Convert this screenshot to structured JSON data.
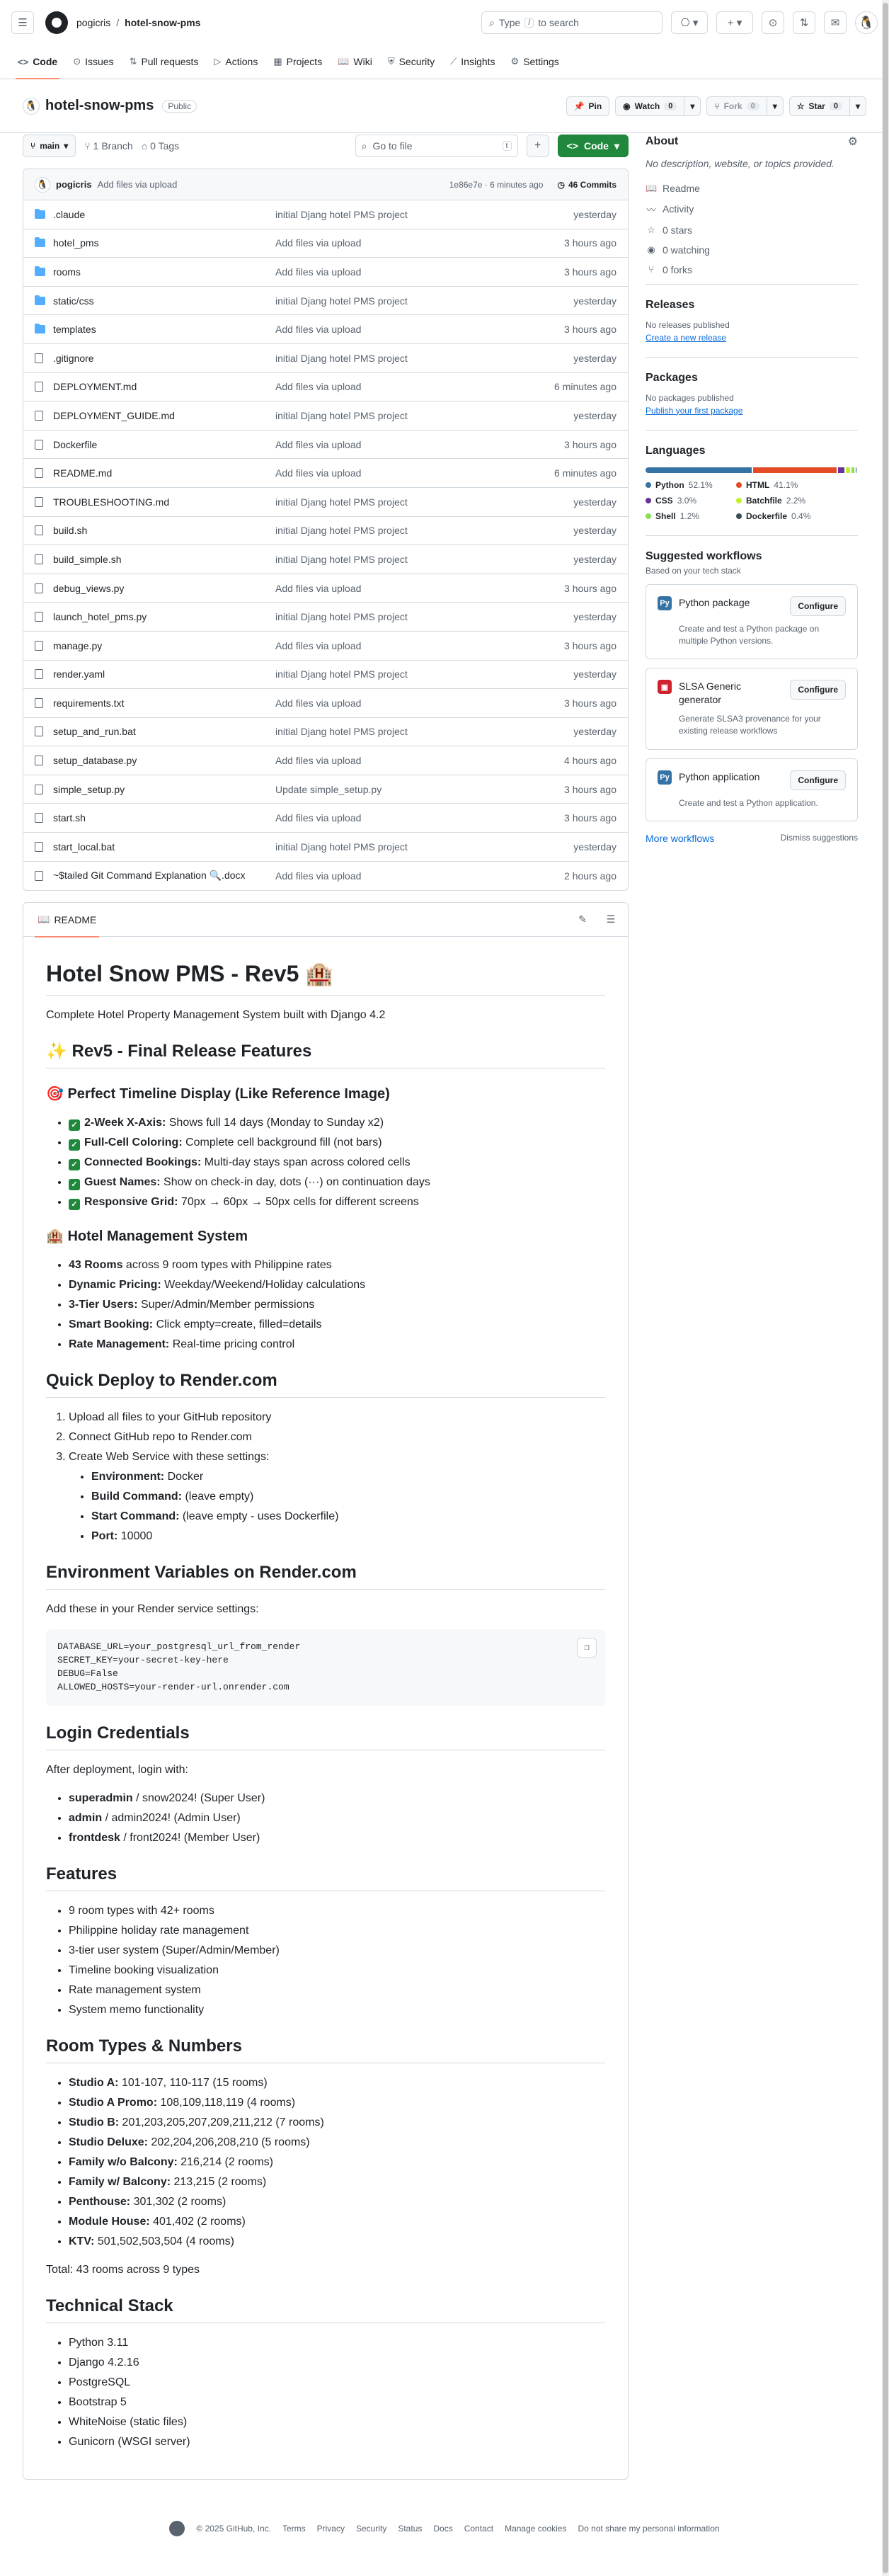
{
  "header": {
    "owner": "pogicris",
    "repo": "hotel-snow-pms",
    "search_placeholder": "Type / to search",
    "search_kbd": "/"
  },
  "tabs": [
    {
      "label": "Code",
      "icon": "code-icon"
    },
    {
      "label": "Issues",
      "icon": "issue-icon"
    },
    {
      "label": "Pull requests",
      "icon": "pull-request-icon"
    },
    {
      "label": "Actions",
      "icon": "actions-icon"
    },
    {
      "label": "Projects",
      "icon": "projects-icon"
    },
    {
      "label": "Wiki",
      "icon": "wiki-icon"
    },
    {
      "label": "Security",
      "icon": "shield-icon"
    },
    {
      "label": "Insights",
      "icon": "graph-icon"
    },
    {
      "label": "Settings",
      "icon": "gear-icon"
    }
  ],
  "repohead": {
    "name": "hotel-snow-pms",
    "visibility": "Public",
    "pin": "Pin",
    "watch": "Watch",
    "watch_count": "0",
    "fork": "Fork",
    "fork_count": "0",
    "star": "Star",
    "star_count": "0"
  },
  "toolbar": {
    "branch": "main",
    "branches": "1 Branch",
    "tags": "0 Tags",
    "goto_placeholder": "Go to file",
    "goto_kbd": "t",
    "code": "Code"
  },
  "commit": {
    "user": "pogicris",
    "message": "Add files via upload",
    "hash_time": "1e86e7e · 6 minutes ago",
    "commits": "46 Commits"
  },
  "files": [
    {
      "name": ".claude",
      "type": "dir",
      "msg": "initial Djang hotel PMS project",
      "date": "yesterday"
    },
    {
      "name": "hotel_pms",
      "type": "dir",
      "msg": "Add files via upload",
      "date": "3 hours ago"
    },
    {
      "name": "rooms",
      "type": "dir",
      "msg": "Add files via upload",
      "date": "3 hours ago"
    },
    {
      "name": "static/css",
      "type": "dir",
      "msg": "initial Djang hotel PMS project",
      "date": "yesterday"
    },
    {
      "name": "templates",
      "type": "dir",
      "msg": "Add files via upload",
      "date": "3 hours ago"
    },
    {
      "name": ".gitignore",
      "type": "file",
      "msg": "initial Djang hotel PMS project",
      "date": "yesterday"
    },
    {
      "name": "DEPLOYMENT.md",
      "type": "file",
      "msg": "Add files via upload",
      "date": "6 minutes ago"
    },
    {
      "name": "DEPLOYMENT_GUIDE.md",
      "type": "file",
      "msg": "initial Djang hotel PMS project",
      "date": "yesterday"
    },
    {
      "name": "Dockerfile",
      "type": "file",
      "msg": "Add files via upload",
      "date": "3 hours ago"
    },
    {
      "name": "README.md",
      "type": "file",
      "msg": "Add files via upload",
      "date": "6 minutes ago"
    },
    {
      "name": "TROUBLESHOOTING.md",
      "type": "file",
      "msg": "initial Djang hotel PMS project",
      "date": "yesterday"
    },
    {
      "name": "build.sh",
      "type": "file",
      "msg": "initial Djang hotel PMS project",
      "date": "yesterday"
    },
    {
      "name": "build_simple.sh",
      "type": "file",
      "msg": "initial Djang hotel PMS project",
      "date": "yesterday"
    },
    {
      "name": "debug_views.py",
      "type": "file",
      "msg": "Add files via upload",
      "date": "3 hours ago"
    },
    {
      "name": "launch_hotel_pms.py",
      "type": "file",
      "msg": "initial Djang hotel PMS project",
      "date": "yesterday"
    },
    {
      "name": "manage.py",
      "type": "file",
      "msg": "Add files via upload",
      "date": "3 hours ago"
    },
    {
      "name": "render.yaml",
      "type": "file",
      "msg": "initial Djang hotel PMS project",
      "date": "yesterday"
    },
    {
      "name": "requirements.txt",
      "type": "file",
      "msg": "Add files via upload",
      "date": "3 hours ago"
    },
    {
      "name": "setup_and_run.bat",
      "type": "file",
      "msg": "initial Djang hotel PMS project",
      "date": "yesterday"
    },
    {
      "name": "setup_database.py",
      "type": "file",
      "msg": "Add files via upload",
      "date": "4 hours ago"
    },
    {
      "name": "simple_setup.py",
      "type": "file",
      "msg": "Update simple_setup.py",
      "date": "3 hours ago"
    },
    {
      "name": "start.sh",
      "type": "file",
      "msg": "Add files via upload",
      "date": "3 hours ago"
    },
    {
      "name": "start_local.bat",
      "type": "file",
      "msg": "initial Djang hotel PMS project",
      "date": "yesterday"
    },
    {
      "name": "~$tailed Git Command Explanation 🔍.docx",
      "type": "file",
      "msg": "Add files via upload",
      "date": "2 hours ago"
    }
  ],
  "readme": {
    "tab": "README",
    "h1": "Hotel Snow PMS - Rev5 🏨",
    "intro": "Complete Hotel Property Management System built with Django 4.2",
    "h2_features": "✨ Rev5 - Final Release Features",
    "h3_timeline": "🎯 Perfect Timeline Display (Like Reference Image)",
    "timeline_items": [
      {
        "bold": "2-Week X-Axis:",
        "rest": " Shows full 14 days (Monday to Sunday x2)"
      },
      {
        "bold": "Full-Cell Coloring:",
        "rest": " Complete cell background fill (not bars)"
      },
      {
        "bold": "Connected Bookings:",
        "rest": " Multi-day stays span across colored cells"
      },
      {
        "bold": "Guest Names:",
        "rest": " Show on check-in day, dots (···) on continuation days"
      },
      {
        "bold": "Responsive Grid:",
        "rest": " 70px → 60px → 50px cells for different screens"
      }
    ],
    "h3_mgmt": "🏨 Hotel Management System",
    "mgmt_items": [
      {
        "bold": "43 Rooms",
        "rest": " across 9 room types with Philippine rates"
      },
      {
        "bold": "Dynamic Pricing:",
        "rest": " Weekday/Weekend/Holiday calculations"
      },
      {
        "bold": "3-Tier Users:",
        "rest": " Super/Admin/Member permissions"
      },
      {
        "bold": "Smart Booking:",
        "rest": " Click empty=create, filled=details"
      },
      {
        "bold": "Rate Management:",
        "rest": " Real-time pricing control"
      }
    ],
    "h2_deploy": "Quick Deploy to Render.com",
    "deploy_steps": [
      "Upload all files to your GitHub repository",
      "Connect GitHub repo to Render.com",
      "Create Web Service with these settings:"
    ],
    "deploy_settings": [
      {
        "bold": "Environment:",
        "rest": " Docker"
      },
      {
        "bold": "Build Command:",
        "rest": " (leave empty)"
      },
      {
        "bold": "Start Command:",
        "rest": " (leave empty - uses Dockerfile)"
      },
      {
        "bold": "Port:",
        "rest": " 10000"
      }
    ],
    "h2_env": "Environment Variables on Render.com",
    "env_intro": "Add these in your Render service settings:",
    "env_code": [
      "DATABASE_URL=your_postgresql_url_from_render",
      "SECRET_KEY=your-secret-key-here",
      "DEBUG=False",
      "ALLOWED_HOSTS=your-render-url.onrender.com"
    ],
    "h2_login": "Login Credentials",
    "login_intro": "After deployment, login with:",
    "login_items": [
      {
        "bold": "superadmin",
        "rest": " / snow2024! (Super User)"
      },
      {
        "bold": "admin",
        "rest": " / admin2024! (Admin User)"
      },
      {
        "bold": "frontdesk",
        "rest": " / front2024! (Member User)"
      }
    ],
    "h2_features2": "Features",
    "features_items": [
      "9 room types with 42+ rooms",
      "Philippine holiday rate management",
      "3-tier user system (Super/Admin/Member)",
      "Timeline booking visualization",
      "Rate management system",
      "System memo functionality"
    ],
    "h2_rooms": "Room Types & Numbers",
    "rooms_items": [
      {
        "bold": "Studio A:",
        "rest": " 101-107, 110-117 (15 rooms)"
      },
      {
        "bold": "Studio A Promo:",
        "rest": " 108,109,118,119 (4 rooms)"
      },
      {
        "bold": "Studio B:",
        "rest": " 201,203,205,207,209,211,212 (7 rooms)"
      },
      {
        "bold": "Studio Deluxe:",
        "rest": " 202,204,206,208,210 (5 rooms)"
      },
      {
        "bold": "Family w/o Balcony:",
        "rest": " 216,214 (2 rooms)"
      },
      {
        "bold": "Family w/ Balcony:",
        "rest": " 213,215 (2 rooms)"
      },
      {
        "bold": "Penthouse:",
        "rest": " 301,302 (2 rooms)"
      },
      {
        "bold": "Module House:",
        "rest": " 401,402 (2 rooms)"
      },
      {
        "bold": "KTV:",
        "rest": " 501,502,503,504 (4 rooms)"
      }
    ],
    "rooms_total": "Total: 43 rooms across 9 types",
    "h2_stack": "Technical Stack",
    "stack_items": [
      "Python 3.11",
      "Django 4.2.16",
      "PostgreSQL",
      "Bootstrap 5",
      "WhiteNoise (static files)",
      "Gunicorn (WSGI server)"
    ]
  },
  "about": {
    "title": "About",
    "desc": "No description, website, or topics provided.",
    "stats": [
      {
        "icon": "book-icon",
        "glyph": "📖",
        "label": "Readme"
      },
      {
        "icon": "pulse-icon",
        "glyph": "〰",
        "label": "Activity"
      },
      {
        "icon": "star-icon",
        "glyph": "☆",
        "label": "0 stars"
      },
      {
        "icon": "eye-icon",
        "glyph": "◉",
        "label": "0 watching"
      },
      {
        "icon": "fork-icon",
        "glyph": "⑂",
        "label": "0 forks"
      }
    ]
  },
  "releases": {
    "title": "Releases",
    "none": "No releases published",
    "link": "Create a new release"
  },
  "packages": {
    "title": "Packages",
    "none": "No packages published",
    "link": "Publish your first package"
  },
  "languages": {
    "title": "Languages",
    "items": [
      {
        "name": "Python",
        "pct": "52.1%",
        "value": 52.1,
        "color": "#3572A5"
      },
      {
        "name": "HTML",
        "pct": "41.1%",
        "value": 41.1,
        "color": "#e34c26"
      },
      {
        "name": "CSS",
        "pct": "3.0%",
        "value": 3.0,
        "color": "#663399"
      },
      {
        "name": "Batchfile",
        "pct": "2.2%",
        "value": 2.2,
        "color": "#C1F12E"
      },
      {
        "name": "Shell",
        "pct": "1.2%",
        "value": 1.2,
        "color": "#89e051"
      },
      {
        "name": "Dockerfile",
        "pct": "0.4%",
        "value": 0.4,
        "color": "#384d54"
      }
    ]
  },
  "workflows": {
    "title": "Suggested workflows",
    "sub": "Based on your tech stack",
    "items": [
      {
        "title": "Python package",
        "desc": "Create and test a Python package on multiple Python versions.",
        "btn": "Configure",
        "color": "#3572A5"
      },
      {
        "title": "SLSA Generic generator",
        "desc": "Generate SLSA3 provenance for your existing release workflows",
        "btn": "Configure",
        "color": "#cf222e"
      },
      {
        "title": "Python application",
        "desc": "Create and test a Python application.",
        "btn": "Configure",
        "color": "#3572A5"
      }
    ],
    "more": "More workflows",
    "dismiss": "Dismiss suggestions"
  },
  "footer": [
    "© 2025 GitHub, Inc.",
    "Terms",
    "Privacy",
    "Security",
    "Status",
    "Docs",
    "Contact",
    "Manage cookies",
    "Do not share my personal information"
  ]
}
